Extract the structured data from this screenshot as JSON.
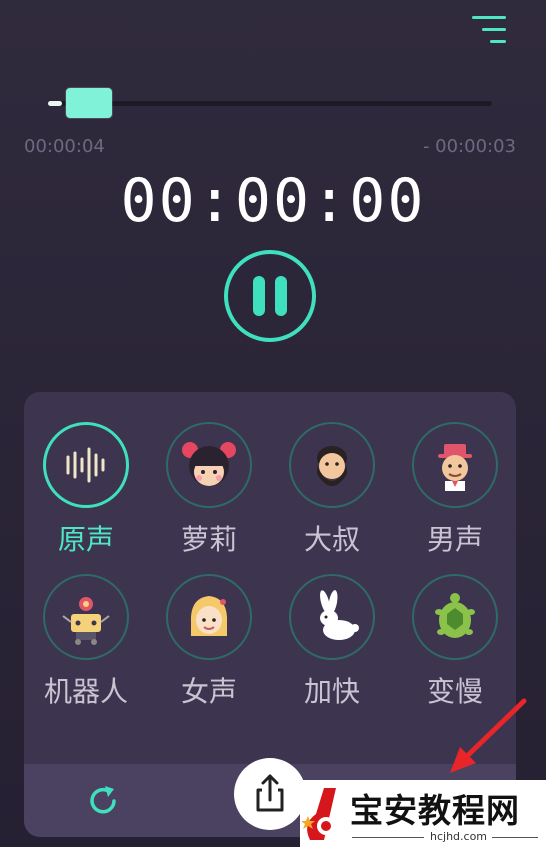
{
  "player": {
    "elapsed": "00:00:04",
    "remaining": "- 00:00:03",
    "clock": "00:00:00",
    "progress": 0.06
  },
  "voices": [
    {
      "label": "原声",
      "icon": "waveform-icon",
      "active": true
    },
    {
      "label": "萝莉",
      "icon": "loli-girl-icon",
      "active": false
    },
    {
      "label": "大叔",
      "icon": "bearded-man-icon",
      "active": false
    },
    {
      "label": "男声",
      "icon": "man-with-hat-icon",
      "active": false
    },
    {
      "label": "机器人",
      "icon": "robot-icon",
      "active": false
    },
    {
      "label": "女声",
      "icon": "woman-icon",
      "active": false
    },
    {
      "label": "加快",
      "icon": "rabbit-icon",
      "active": false
    },
    {
      "label": "变慢",
      "icon": "turtle-icon",
      "active": false
    }
  ],
  "watermark": {
    "text": "宝安教程网",
    "url": "hcjhd.com"
  },
  "colors": {
    "accent": "#3fe0bd",
    "background": "#2b2538",
    "panel": "#3d354f",
    "footer": "#4a4260"
  }
}
